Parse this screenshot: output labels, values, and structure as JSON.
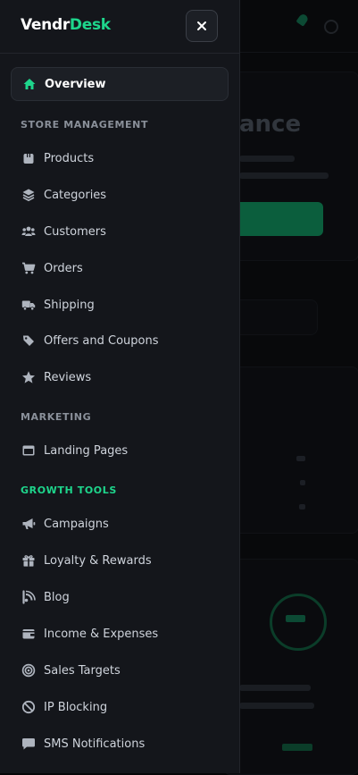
{
  "brand": {
    "part1": "Vendr",
    "part2": "Desk"
  },
  "colors": {
    "accent": "#1ed68c",
    "drawer_bg": "#14161b",
    "text": "#cfd4dc",
    "section": "#8a909a"
  },
  "nav": {
    "active": {
      "label": "Overview",
      "icon": "home-icon"
    },
    "sections": [
      {
        "title": "STORE MANAGEMENT",
        "items": [
          {
            "label": "Products",
            "icon": "box-icon"
          },
          {
            "label": "Categories",
            "icon": "layers-icon"
          },
          {
            "label": "Customers",
            "icon": "users-icon"
          },
          {
            "label": "Orders",
            "icon": "cart-icon"
          },
          {
            "label": "Shipping",
            "icon": "truck-icon"
          },
          {
            "label": "Offers and Coupons",
            "icon": "tag-icon"
          },
          {
            "label": "Reviews",
            "icon": "star-icon"
          }
        ]
      },
      {
        "title": "MARKETING",
        "items": [
          {
            "label": "Landing Pages",
            "icon": "browser-icon"
          }
        ]
      },
      {
        "title": "GROWTH TOOLS",
        "items": [
          {
            "label": "Campaigns",
            "icon": "megaphone-icon"
          },
          {
            "label": "Loyalty & Rewards",
            "icon": "gift-icon"
          },
          {
            "label": "Blog",
            "icon": "blog-icon"
          },
          {
            "label": "Income & Expenses",
            "icon": "wallet-icon"
          },
          {
            "label": "Sales Targets",
            "icon": "target-icon"
          },
          {
            "label": "IP Blocking",
            "icon": "block-icon"
          },
          {
            "label": "SMS Notifications",
            "icon": "message-icon"
          }
        ]
      }
    ]
  }
}
